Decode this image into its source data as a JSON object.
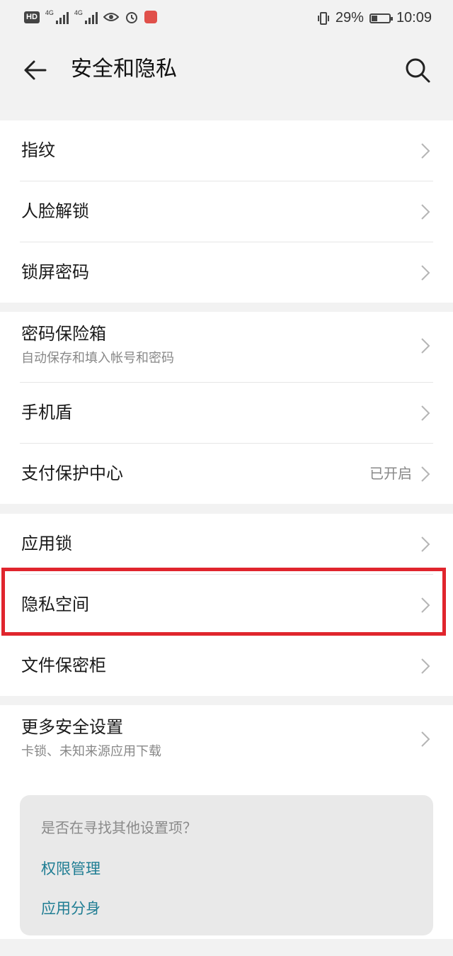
{
  "status_bar": {
    "hd_badge": "HD",
    "network_1": "4G",
    "network_2": "4G",
    "battery_percent": "29%",
    "time": "10:09"
  },
  "header": {
    "title": "安全和隐私",
    "back_icon": "arrow-left-icon",
    "search_icon": "search-icon"
  },
  "groups": {
    "g1": [
      {
        "label": "指纹"
      },
      {
        "label": "人脸解锁"
      },
      {
        "label": "锁屏密码"
      }
    ],
    "g2": [
      {
        "label": "密码保险箱",
        "sub": "自动保存和填入帐号和密码"
      },
      {
        "label": "手机盾"
      },
      {
        "label": "支付保护中心",
        "value": "已开启"
      }
    ],
    "g3": [
      {
        "label": "应用锁"
      },
      {
        "label": "隐私空间"
      },
      {
        "label": "文件保密柜"
      }
    ],
    "g4": [
      {
        "label": "更多安全设置",
        "sub": "卡锁、未知来源应用下载"
      }
    ]
  },
  "suggestions": {
    "question": "是否在寻找其他设置项？",
    "links": [
      "权限管理",
      "应用分身"
    ]
  },
  "colors": {
    "highlight": "#e0252d",
    "link": "#1f7d93",
    "background": "#f2f2f2"
  }
}
